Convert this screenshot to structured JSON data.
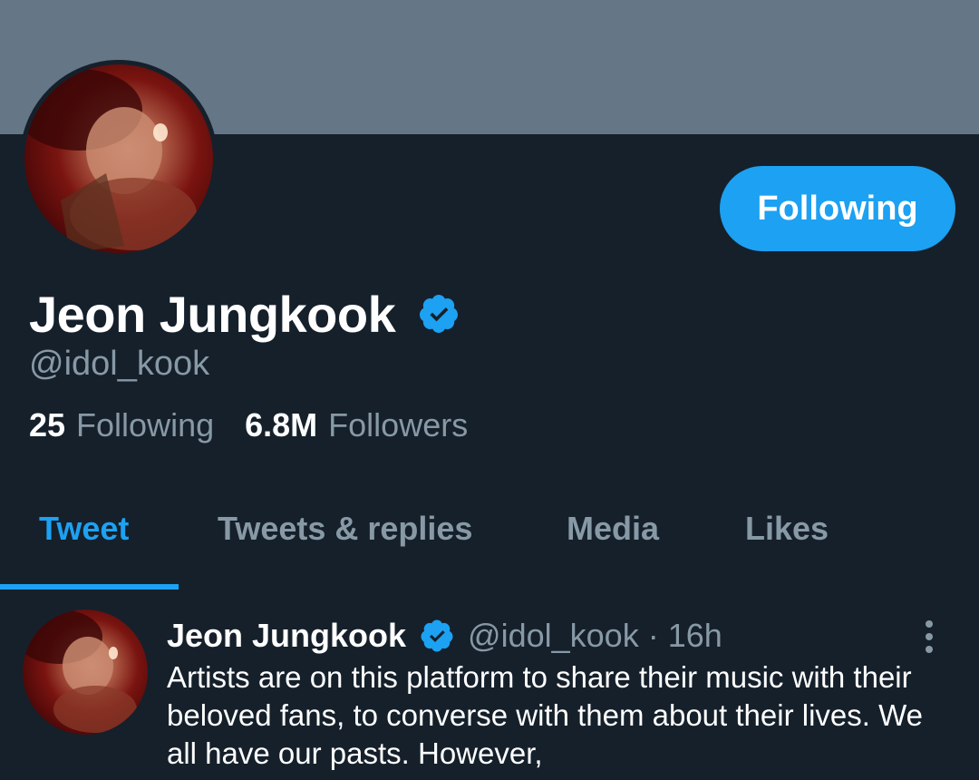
{
  "profile": {
    "name": "Jeon Jungkook",
    "handle": "@idol_kook",
    "following_count": "25",
    "following_label": "Following",
    "followers_count": "6.8M",
    "followers_label": "Followers",
    "follow_button_label": "Following",
    "verified_icon": "verified-badge-icon",
    "avatar_icon": "profile-avatar-image"
  },
  "tabs": [
    {
      "label": "Tweet",
      "active": true
    },
    {
      "label": "Tweets & replies",
      "active": false
    },
    {
      "label": "Media",
      "active": false
    },
    {
      "label": "Likes",
      "active": false
    }
  ],
  "tweet": {
    "author_name": "Jeon Jungkook",
    "author_handle": "@idol_kook",
    "separator": "·",
    "time": "16h",
    "text": "Artists are on this platform to share their music with their beloved fans, to converse with them about their lives. We all have our pasts. However,",
    "more_icon": "more-vertical-icon"
  },
  "colors": {
    "background": "#15202b",
    "banner": "#657786",
    "accent": "#1da1f2",
    "muted_text": "#8899a6",
    "text": "#ffffff"
  }
}
